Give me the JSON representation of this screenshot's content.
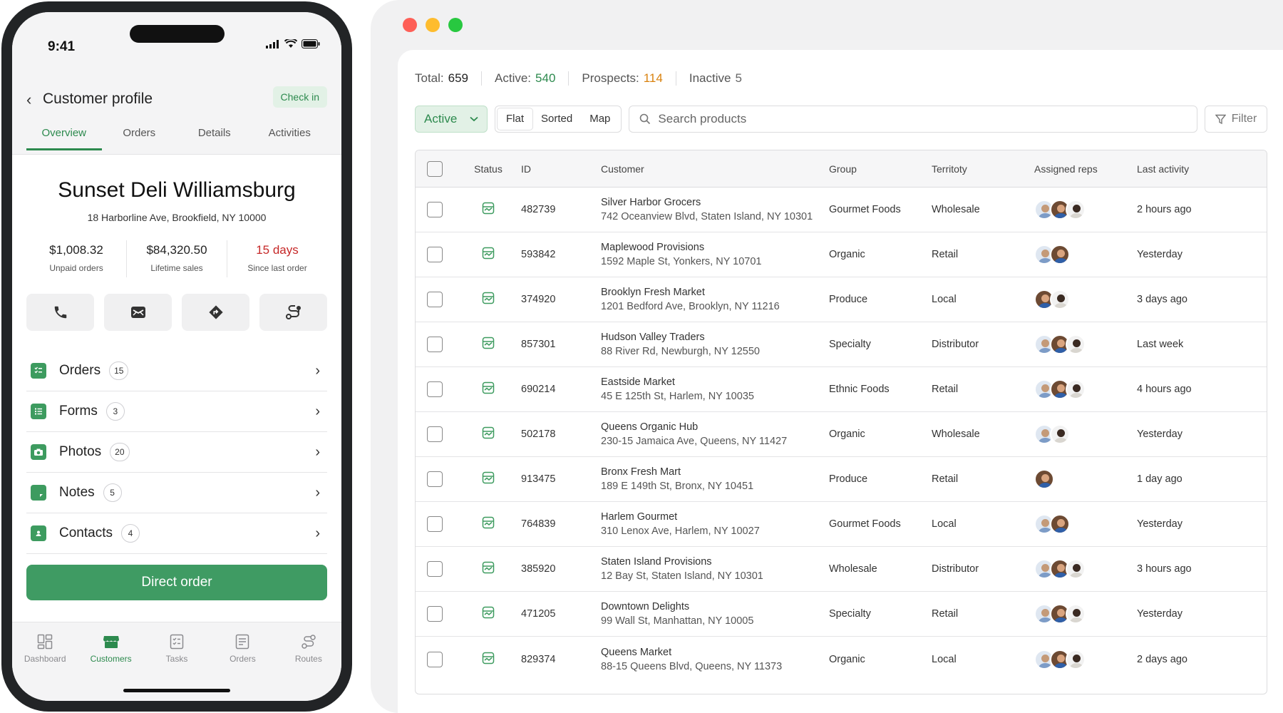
{
  "mobile": {
    "status_bar": {
      "time": "9:41"
    },
    "header": {
      "back_icon": "chevron-left-icon",
      "title": "Customer profile",
      "check_in_label": "Check in"
    },
    "tabs": [
      {
        "label": "Overview",
        "active": true
      },
      {
        "label": "Orders",
        "active": false
      },
      {
        "label": "Details",
        "active": false
      },
      {
        "label": "Activities",
        "active": false
      }
    ],
    "customer": {
      "name": "Sunset Deli Williamsburg",
      "address": "18 Harborline Ave, Brookfield, NY 10000"
    },
    "stats": [
      {
        "value": "$1,008.32",
        "label": "Unpaid orders"
      },
      {
        "value": "$84,320.50",
        "label": "Lifetime sales"
      },
      {
        "value": "15 days",
        "label": "Since last order",
        "color": "#c62828"
      }
    ],
    "actions": [
      {
        "icon": "phone-icon"
      },
      {
        "icon": "mail-icon"
      },
      {
        "icon": "directions-icon"
      },
      {
        "icon": "route-icon"
      }
    ],
    "list": [
      {
        "icon": "checklist-icon",
        "label": "Orders",
        "count": "15"
      },
      {
        "icon": "list-icon",
        "label": "Forms",
        "count": "3"
      },
      {
        "icon": "camera-icon",
        "label": "Photos",
        "count": "20"
      },
      {
        "icon": "note-icon",
        "label": "Notes",
        "count": "5"
      },
      {
        "icon": "contacts-icon",
        "label": "Contacts",
        "count": "4"
      }
    ],
    "direct_order_label": "Direct order",
    "bottom_nav": [
      {
        "label": "Dashboard",
        "icon": "dashboard-icon",
        "active": false
      },
      {
        "label": "Customers",
        "icon": "store-icon",
        "active": true
      },
      {
        "label": "Tasks",
        "icon": "tasks-icon",
        "active": false
      },
      {
        "label": "Orders",
        "icon": "orders-icon",
        "active": false
      },
      {
        "label": "Routes",
        "icon": "routes-icon",
        "active": false
      }
    ],
    "accent_color": "#3f9b63"
  },
  "desktop": {
    "counts": [
      {
        "label": "Total:",
        "value": "659",
        "color": "#222222"
      },
      {
        "label": "Active:",
        "value": "540",
        "color": "#2d8a4e"
      },
      {
        "label": "Prospects:",
        "value": "114",
        "color": "#d9820f"
      },
      {
        "label": "Inactive",
        "value": "5",
        "color": "#666666"
      }
    ],
    "toolbar": {
      "status_select": "Active",
      "view_options": [
        {
          "label": "Flat",
          "active": true
        },
        {
          "label": "Sorted",
          "active": false
        },
        {
          "label": "Map",
          "active": false
        }
      ],
      "search_placeholder": "Search products",
      "filter_label": "Filter"
    },
    "table": {
      "columns": [
        "Status",
        "ID",
        "Customer",
        "Group",
        "Territoty",
        "Assigned reps",
        "Last activity"
      ],
      "rows": [
        {
          "id": "482739",
          "name": "Silver Harbor Grocers",
          "address": "742 Oceanview Blvd, Staten Island, NY 10301",
          "group": "Gourmet Foods",
          "territory": "Wholesale",
          "reps": [
            "a",
            "b",
            "c"
          ],
          "last": "2 hours ago"
        },
        {
          "id": "593842",
          "name": "Maplewood Provisions",
          "address": "1592 Maple St, Yonkers, NY 10701",
          "group": "Organic",
          "territory": "Retail",
          "reps": [
            "a",
            "b"
          ],
          "last": "Yesterday"
        },
        {
          "id": "374920",
          "name": "Brooklyn Fresh Market",
          "address": "1201 Bedford Ave, Brooklyn, NY 11216",
          "group": "Produce",
          "territory": "Local",
          "reps": [
            "b",
            "c"
          ],
          "last": "3 days ago"
        },
        {
          "id": "857301",
          "name": "Hudson Valley Traders",
          "address": "88 River Rd, Newburgh, NY 12550",
          "group": "Specialty",
          "territory": "Distributor",
          "reps": [
            "a",
            "b",
            "c"
          ],
          "last": "Last week"
        },
        {
          "id": "690214",
          "name": "Eastside Market",
          "address": "45 E 125th St, Harlem, NY 10035",
          "group": "Ethnic Foods",
          "territory": "Retail",
          "reps": [
            "a",
            "b",
            "c"
          ],
          "last": "4 hours ago"
        },
        {
          "id": "502178",
          "name": "Queens Organic Hub",
          "address": "230-15 Jamaica Ave, Queens, NY 11427",
          "group": "Organic",
          "territory": "Wholesale",
          "reps": [
            "a",
            "c"
          ],
          "last": "Yesterday"
        },
        {
          "id": "913475",
          "name": "Bronx Fresh Mart",
          "address": "189 E 149th St, Bronx, NY 10451",
          "group": "Produce",
          "territory": "Retail",
          "reps": [
            "b"
          ],
          "last": "1 day ago"
        },
        {
          "id": "764839",
          "name": "Harlem Gourmet",
          "address": "310 Lenox Ave, Harlem, NY 10027",
          "group": "Gourmet Foods",
          "territory": "Local",
          "reps": [
            "a",
            "b"
          ],
          "last": "Yesterday"
        },
        {
          "id": "385920",
          "name": "Staten Island Provisions",
          "address": "12 Bay St, Staten Island, NY 10301",
          "group": "Wholesale",
          "territory": "Distributor",
          "reps": [
            "a",
            "b",
            "c"
          ],
          "last": "3 hours ago"
        },
        {
          "id": "471205",
          "name": "Downtown Delights",
          "address": "99 Wall St, Manhattan, NY 10005",
          "group": "Specialty",
          "territory": "Retail",
          "reps": [
            "a",
            "b",
            "c"
          ],
          "last": "Yesterday"
        },
        {
          "id": "829374",
          "name": "Queens Market",
          "address": "88-15 Queens Blvd, Queens, NY 11373",
          "group": "Organic",
          "territory": "Local",
          "reps": [
            "a",
            "b",
            "c"
          ],
          "last": "2 days ago"
        }
      ]
    }
  }
}
